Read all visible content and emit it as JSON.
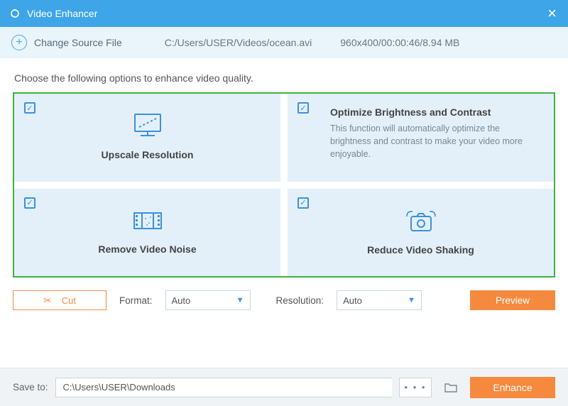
{
  "titlebar": {
    "title": "Video Enhancer"
  },
  "source": {
    "change_label": "Change Source File",
    "path": "C:/Users/USER/Videos/ocean.avi",
    "info": "960x400/00:00:46/8.94 MB"
  },
  "instruction": "Choose the following options to enhance video quality.",
  "options": {
    "upscale": {
      "title": "Upscale Resolution"
    },
    "brightness": {
      "title": "Optimize Brightness and Contrast",
      "desc": "This function will automatically optimize the brightness and contrast to make your video more enjoyable."
    },
    "noise": {
      "title": "Remove Video Noise"
    },
    "shaking": {
      "title": "Reduce Video Shaking"
    }
  },
  "controls": {
    "cut": "Cut",
    "format_label": "Format:",
    "format_value": "Auto",
    "resolution_label": "Resolution:",
    "resolution_value": "Auto",
    "preview": "Preview"
  },
  "bottom": {
    "save_label": "Save to:",
    "save_path": "C:\\Users\\USER\\Downloads",
    "enhance": "Enhance"
  }
}
